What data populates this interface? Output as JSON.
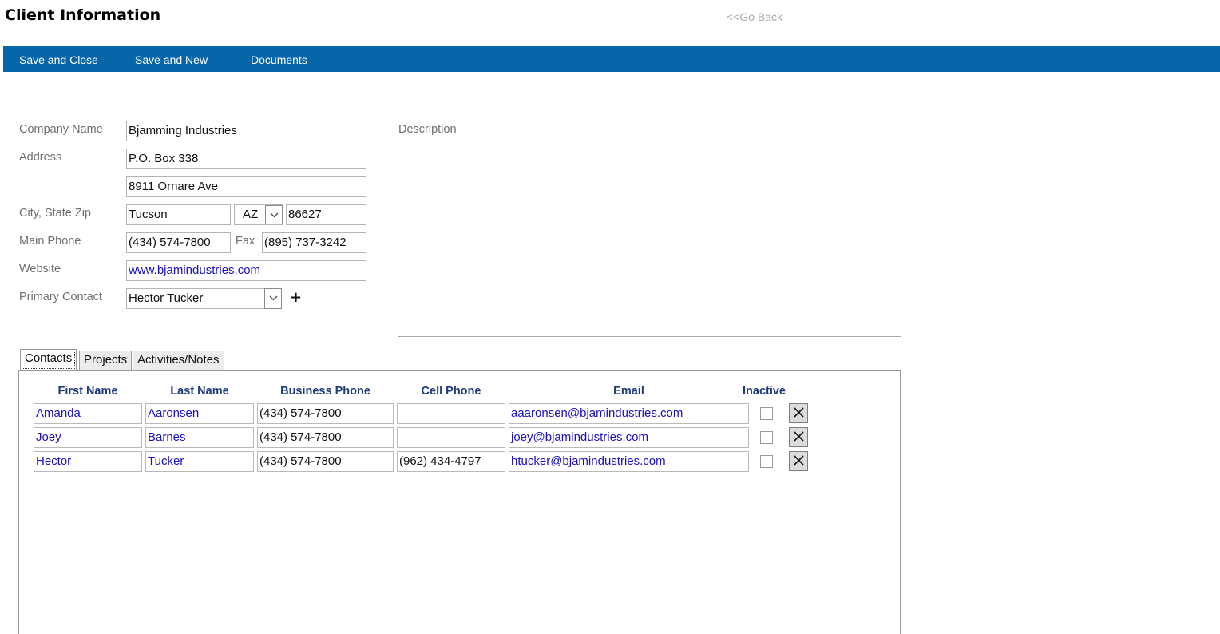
{
  "header": {
    "title": "Client Information",
    "go_back": "<<Go Back"
  },
  "toolbar": {
    "save_close_pre": "Save and ",
    "save_close_key": "C",
    "save_close_post": "lose",
    "save_new_key": "S",
    "save_new_post": "ave and New",
    "documents_key": "D",
    "documents_post": "ocuments",
    "color": "#0766a9"
  },
  "form": {
    "company_name_label": "Company Name",
    "company_name": "Bjamming Industries",
    "address_label": "Address",
    "address_line1": "P.O. Box 338",
    "address_line2": "8911 Ornare Ave",
    "city_state_zip_label": "City, State Zip",
    "city": "Tucson",
    "state": "AZ",
    "zip": "86627",
    "main_phone_label": "Main Phone",
    "main_phone": "(434) 574-7800",
    "fax_label": "Fax",
    "fax": "(895) 737-3242",
    "website_label": "Website",
    "website": "www.bjamindustries.com",
    "primary_contact_label": "Primary Contact",
    "primary_contact": "Hector Tucker",
    "add_contact_symbol": "+",
    "description_label": "Description",
    "description": ""
  },
  "tabs": [
    {
      "label": "Contacts",
      "active": true
    },
    {
      "label": "Projects",
      "active": false
    },
    {
      "label": "Activities/Notes",
      "active": false
    }
  ],
  "contacts": {
    "columns": [
      "First Name",
      "Last Name",
      "Business Phone",
      "Cell Phone",
      "Email",
      "Inactive"
    ],
    "rows": [
      {
        "first": "Amanda",
        "last": "Aaronsen",
        "business_phone": "(434) 574-7800",
        "cell_phone": "",
        "email": "aaaronsen@bjamindustries.com",
        "inactive": false
      },
      {
        "first": "Joey",
        "last": "Barnes",
        "business_phone": "(434) 574-7800",
        "cell_phone": "",
        "email": "joey@bjamindustries.com",
        "inactive": false
      },
      {
        "first": "Hector",
        "last": "Tucker",
        "business_phone": "(434) 574-7800",
        "cell_phone": "(962) 434-4797",
        "email": "htucker@bjamindustries.com",
        "inactive": false
      }
    ]
  }
}
